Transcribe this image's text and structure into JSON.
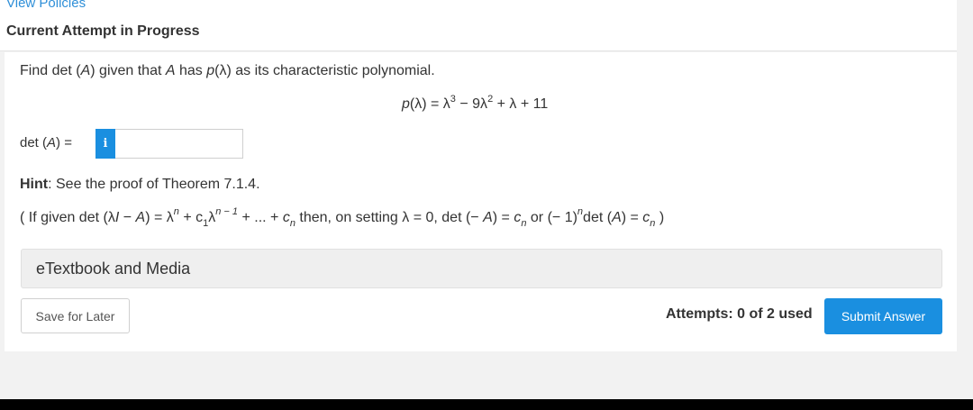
{
  "header": {
    "view_policies": "View Policies",
    "attempt_title": "Current Attempt in Progress"
  },
  "question": {
    "prompt_parts": [
      "Find det (",
      "A",
      ") given that ",
      "A",
      " has ",
      "p",
      "(λ) as its characteristic polynomial."
    ],
    "equation": {
      "lhs_p": "p",
      "lhs_rest": "(λ) = λ",
      "exp1": "3",
      "mid": " − 9λ",
      "exp2": "2",
      "tail": " + λ + 11"
    },
    "answer": {
      "label_pre": "det (",
      "label_var": "A",
      "label_post": ") =",
      "info_icon": "i",
      "value": ""
    },
    "hint": {
      "label": "Hint",
      "text": ": See the proof of Theorem 7.1.4."
    },
    "formula": {
      "p1": "( If given det (λ",
      "I": "I",
      "p2": " − ",
      "A1": "A",
      "p3": ") = λ",
      "n1": "n",
      "p4": " + c",
      "one": "1",
      "p5": "λ",
      "nminus1": "n − 1",
      "p6": " + ... + ",
      "c1": "c",
      "n2": "n",
      "p7": " then, on setting λ = 0, det (− ",
      "A2": "A",
      "p8": ") = ",
      "c2": "c",
      "n3": "n",
      "p9": " or (− 1)",
      "n4": "n",
      "p10": "det (",
      "A3": "A",
      "p11": ") = ",
      "c3": "c",
      "n5": "n",
      "p12": " )"
    }
  },
  "resources": {
    "etextbook_label": "eTextbook and Media"
  },
  "footer": {
    "save_label": "Save for Later",
    "attempts_text": "Attempts: 0 of 2 used",
    "submit_label": "Submit Answer"
  },
  "colors": {
    "accent": "#1a8fe0",
    "link": "#2f8fd8",
    "text": "#333333"
  }
}
